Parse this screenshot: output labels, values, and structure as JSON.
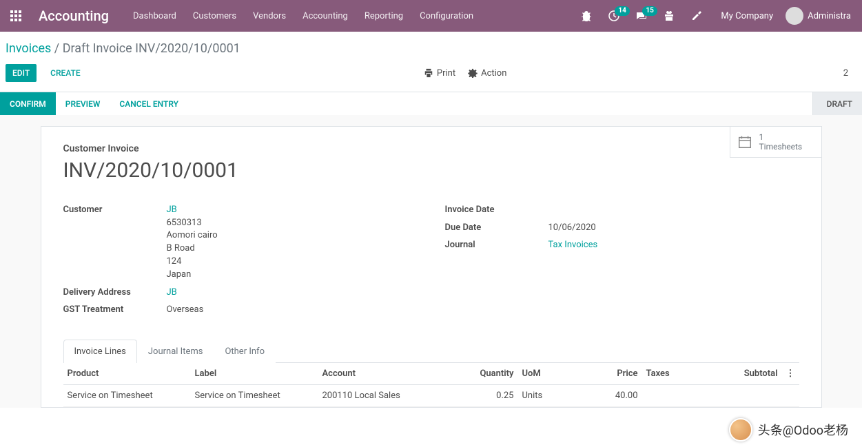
{
  "nav": {
    "brand": "Accounting",
    "menu": [
      "Dashboard",
      "Customers",
      "Vendors",
      "Accounting",
      "Reporting",
      "Configuration"
    ],
    "badge_clock": "14",
    "badge_chat": "15",
    "company": "My Company",
    "user": "Administra"
  },
  "breadcrumb": {
    "root": "Invoices",
    "sep": "/",
    "current": "Draft Invoice INV/2020/10/0001"
  },
  "actions": {
    "edit": "EDIT",
    "create": "CREATE",
    "print": "Print",
    "action": "Action",
    "pager": "2"
  },
  "status": {
    "confirm": "CONFIRM",
    "preview": "PREVIEW",
    "cancel": "CANCEL ENTRY",
    "stage": "DRAFT"
  },
  "stat": {
    "count": "1",
    "label": "Timesheets"
  },
  "doc": {
    "type": "Customer Invoice",
    "name": "INV/2020/10/0001"
  },
  "left": {
    "customer_label": "Customer",
    "customer_link": "JB",
    "addr1": "6530313",
    "addr2": "Aomori cairo",
    "addr3": "B Road",
    "addr4": "124",
    "addr5": "Japan",
    "delivery_label": "Delivery Address",
    "delivery_link": "JB",
    "gst_label": "GST Treatment",
    "gst_value": "Overseas"
  },
  "right": {
    "invdate_label": "Invoice Date",
    "invdate_value": "",
    "due_label": "Due Date",
    "due_value": "10/06/2020",
    "journal_label": "Journal",
    "journal_link": "Tax Invoices"
  },
  "tabs": {
    "lines": "Invoice Lines",
    "journal": "Journal Items",
    "other": "Other Info"
  },
  "table": {
    "headers": {
      "product": "Product",
      "label": "Label",
      "account": "Account",
      "quantity": "Quantity",
      "uom": "UoM",
      "price": "Price",
      "taxes": "Taxes",
      "subtotal": "Subtotal"
    },
    "row": {
      "product": "Service on Timesheet",
      "label": "Service on Timesheet",
      "account": "200110 Local Sales",
      "quantity": "0.25",
      "uom": "Units",
      "price": "40.00",
      "taxes": "",
      "subtotal": ""
    }
  },
  "wm": "头条@Odoo老杨"
}
